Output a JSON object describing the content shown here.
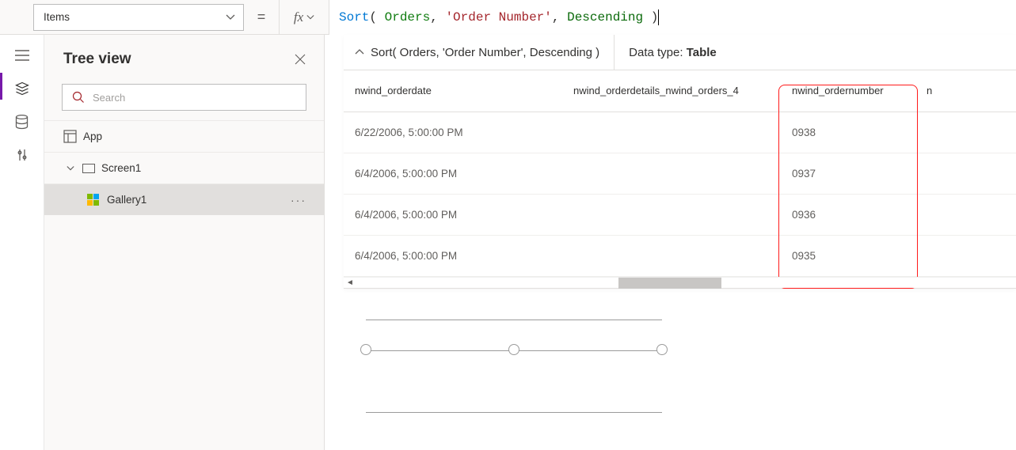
{
  "property_select": {
    "value": "Items"
  },
  "equals": "=",
  "fx_label": "fx",
  "formula_tokens": {
    "fn": "Sort",
    "open": "(",
    "p1": "Orders",
    "comma1": ",",
    "p2": "'Order Number'",
    "comma2": ",",
    "p3": "Descending",
    "close": ")"
  },
  "tree": {
    "title": "Tree view",
    "search_placeholder": "Search",
    "items": [
      {
        "label": "App"
      },
      {
        "label": "Screen1"
      },
      {
        "label": "Gallery1"
      }
    ]
  },
  "result": {
    "formula_text": "Sort( Orders, 'Order Number', Descending )",
    "datatype_label": "Data type:",
    "datatype_value": "Table",
    "columns": [
      "nwind_orderdate",
      "nwind_orderdetails_nwind_orders_4",
      "nwind_ordernumber",
      "n"
    ],
    "rows": [
      {
        "c0": "6/22/2006, 5:00:00 PM",
        "c1": "",
        "c2": "0938"
      },
      {
        "c0": "6/4/2006, 5:00:00 PM",
        "c1": "",
        "c2": "0937"
      },
      {
        "c0": "6/4/2006, 5:00:00 PM",
        "c1": "",
        "c2": "0936"
      },
      {
        "c0": "6/4/2006, 5:00:00 PM",
        "c1": "",
        "c2": "0935"
      }
    ]
  }
}
